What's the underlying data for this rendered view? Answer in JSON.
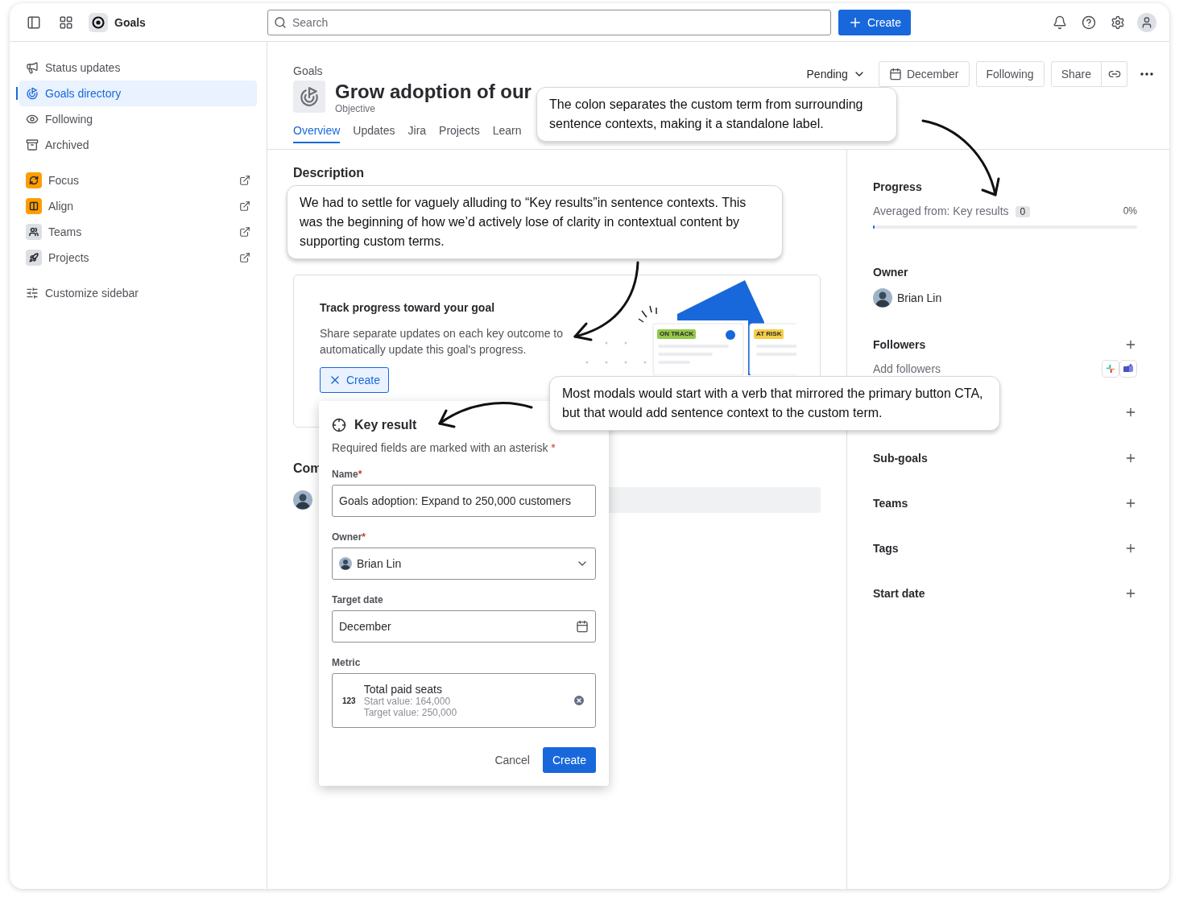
{
  "topbar": {
    "app_name": "Goals",
    "search": {
      "placeholder": "Search"
    },
    "create": "Create"
  },
  "sidebar": {
    "nav": [
      {
        "label": "Status updates",
        "selected": false
      },
      {
        "label": "Goals directory",
        "selected": true
      },
      {
        "label": "Following",
        "selected": false
      },
      {
        "label": "Archived",
        "selected": false
      }
    ],
    "apps": [
      {
        "label": "Focus",
        "color": "#ff9d00"
      },
      {
        "label": "Align",
        "color": "#ff9d00"
      },
      {
        "label": "Teams",
        "color": "#dcdfe4"
      },
      {
        "label": "Projects",
        "color": "#dcdfe4"
      }
    ],
    "customize": "Customize sidebar"
  },
  "goal": {
    "breadcrumb": "Goals",
    "title": "Grow adoption of our",
    "type": "Objective",
    "status": "Pending",
    "date": "December",
    "follow": "Following",
    "share": "Share",
    "tabs": [
      {
        "label": "Overview",
        "selected": true
      },
      {
        "label": "Updates",
        "selected": false
      },
      {
        "label": "Jira",
        "selected": false
      },
      {
        "label": "Projects",
        "selected": false
      },
      {
        "label": "Learn",
        "selected": false
      }
    ]
  },
  "main": {
    "description_heading": "Description",
    "card": {
      "title": "Track progress toward your goal",
      "text": "Share separate updates on each key outcome to automatically update this goal's progress.",
      "button": "Create",
      "badges": [
        {
          "label": "ON TRACK",
          "color": "#94c748"
        },
        {
          "label": "AT RISK",
          "color": "#f5cd47"
        }
      ]
    },
    "comments_heading": "Com"
  },
  "details": {
    "progress": {
      "label": "Progress",
      "source": "Averaged from: Key results",
      "count": "0",
      "percent": "0%",
      "level": 0
    },
    "owner": {
      "label": "Owner",
      "name": "Brian Lin"
    },
    "followers": {
      "label": "Followers",
      "placeholder": "Add followers"
    },
    "sections": [
      "Sub-goals",
      "Teams",
      "Tags",
      "Start date"
    ]
  },
  "modal": {
    "title": "Key result",
    "note": "Required fields are marked with an asterisk",
    "asterisk": "*",
    "name": {
      "label": "Name",
      "required": true,
      "value": "Goals adoption: Expand to 250,000 customers"
    },
    "owner": {
      "label": "Owner",
      "required": true,
      "value": "Brian Lin"
    },
    "target_date": {
      "label": "Target date",
      "required": false,
      "value": "December"
    },
    "metric": {
      "label": "Metric",
      "symbol": "123",
      "title": "Total paid seats",
      "start": "Start value: 164,000",
      "target": "Target value: 250,000"
    },
    "cancel": "Cancel",
    "submit": "Create"
  },
  "callouts": [
    "The colon separates the custom term from surrounding sentence contexts, making it a standalone label.",
    "We had to settle for vaguely alluding to “Key results”in sentence contexts. This was the beginning of how we’d actively lose of clarity in contextual content by supporting custom terms.",
    "Most modals would start with a verb that mirrored the primary button CTA, but that would add sentence context to the custom term."
  ]
}
